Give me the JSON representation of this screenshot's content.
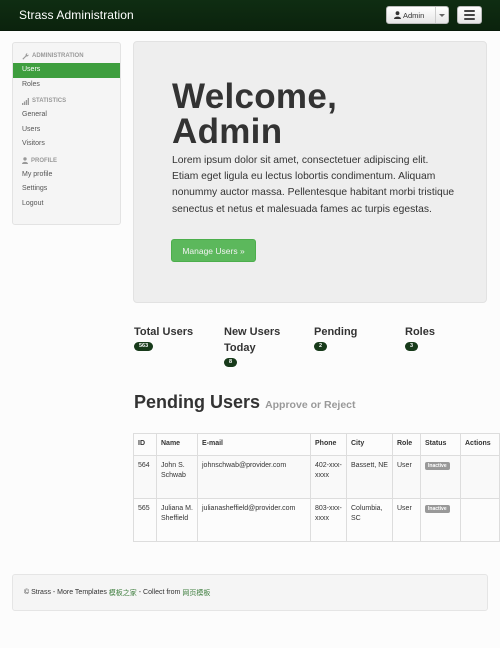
{
  "navbar": {
    "brand": "Strass Administration",
    "user_button_label": "Admin",
    "user_icon": "user-icon",
    "menu_icon": "hamburger-icon"
  },
  "sidebar": {
    "sections": [
      {
        "header": "Administration",
        "icon": "wrench-icon",
        "items": [
          "Users",
          "Roles"
        ],
        "active": "Users"
      },
      {
        "header": "Statistics",
        "icon": "signal-icon",
        "items": [
          "General",
          "Users",
          "Visitors"
        ]
      },
      {
        "header": "Profile",
        "icon": "user-icon",
        "items": [
          "My profile",
          "Settings",
          "Logout"
        ]
      }
    ]
  },
  "hero": {
    "heading_line1": "Welcome,",
    "heading_line2": "Admin",
    "paragraph": "Lorem ipsum dolor sit amet, consectetuer adipiscing elit. Etiam eget ligula eu lectus lobortis condimentum. Aliquam nonummy auctor massa. Pellentesque habitant morbi tristique senectus et netus et malesuada fames ac turpis egestas.",
    "button_label": "Manage Users »"
  },
  "stats": [
    {
      "title": "Total Users",
      "value": "563"
    },
    {
      "title": "New Users Today",
      "value": "8"
    },
    {
      "title": "Pending",
      "value": "2"
    },
    {
      "title": "Roles",
      "value": "3"
    }
  ],
  "pending": {
    "title": "Pending Users",
    "subtitle": "Approve or Reject"
  },
  "table": {
    "columns": [
      "ID",
      "Name",
      "E-mail",
      "Phone",
      "City",
      "Role",
      "Status",
      "Actions"
    ],
    "rows": [
      {
        "id": "564",
        "name": "John S. Schwab",
        "email": "johnschwab@provider.com",
        "phone": "402-xxx-xxxx",
        "city": "Bassett, NE",
        "role": "User",
        "status": "Inactive",
        "actions": ""
      },
      {
        "id": "565",
        "name": "Juliana M. Sheffield",
        "email": "julianasheffield@provider.com",
        "phone": "803-xxx-xxxx",
        "city": "Columbia, SC",
        "role": "User",
        "status": "Inactive",
        "actions": ""
      }
    ]
  },
  "footer": {
    "text_prefix": "© Strass - More Templates",
    "link1": "模板之家",
    "text_middle": "- Collect from",
    "link2": "网页模板"
  },
  "colors": {
    "navbar": "#0f2d12",
    "active_nav": "#3e9e3e",
    "button_success": "#5cb85c",
    "badge": "#173a1a"
  }
}
